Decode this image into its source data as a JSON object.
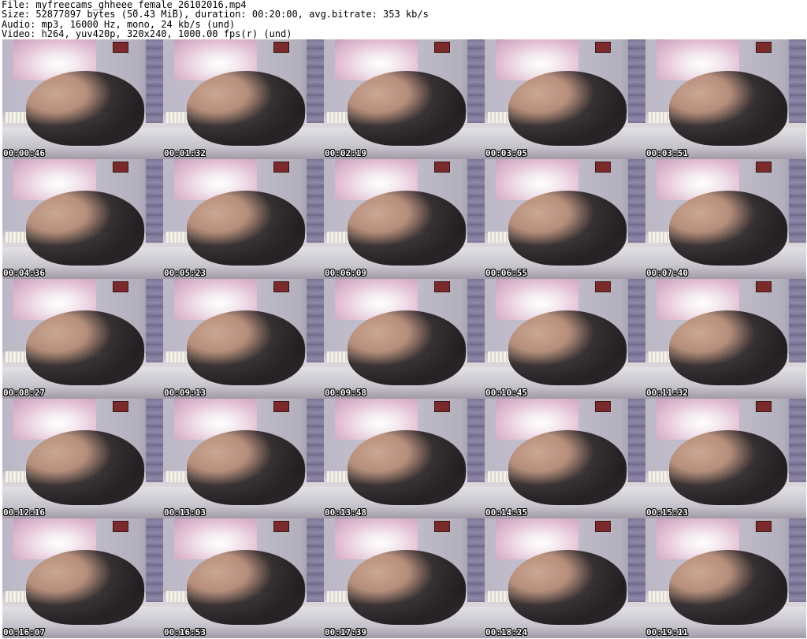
{
  "header": {
    "lines": [
      "File: myfreecams_ghheee_female_26102016.mp4",
      "Size: 52877897 bytes (50.43 MiB), duration: 00:20:00, avg.bitrate: 353 kb/s",
      "Audio: mp3, 16000 Hz, mono, 24 kb/s (und)",
      "Video: h264, yuv420p, 320x240, 1000.00 fps(r) (und)"
    ]
  },
  "thumbnails": [
    {
      "timestamp": "00:00:46"
    },
    {
      "timestamp": "00:01:32"
    },
    {
      "timestamp": "00:02:19"
    },
    {
      "timestamp": "00:03:05"
    },
    {
      "timestamp": "00:03:51"
    },
    {
      "timestamp": "00:04:36"
    },
    {
      "timestamp": "00:05:23"
    },
    {
      "timestamp": "00:06:09"
    },
    {
      "timestamp": "00:06:55"
    },
    {
      "timestamp": "00:07:40"
    },
    {
      "timestamp": "00:08:27"
    },
    {
      "timestamp": "00:09:13"
    },
    {
      "timestamp": "00:09:58"
    },
    {
      "timestamp": "00:10:45"
    },
    {
      "timestamp": "00:11:32"
    },
    {
      "timestamp": "00:12:16"
    },
    {
      "timestamp": "00:13:03"
    },
    {
      "timestamp": "00:13:48"
    },
    {
      "timestamp": "00:14:35"
    },
    {
      "timestamp": "00:15:23"
    },
    {
      "timestamp": "00:16:07"
    },
    {
      "timestamp": "00:16:53"
    },
    {
      "timestamp": "00:17:39"
    },
    {
      "timestamp": "00:18:24"
    },
    {
      "timestamp": "00:19:11"
    }
  ],
  "colors": {
    "background": "#ffffff",
    "header_text": "#000000",
    "timestamp_text": "#ffffff",
    "timestamp_outline": "#000000"
  }
}
